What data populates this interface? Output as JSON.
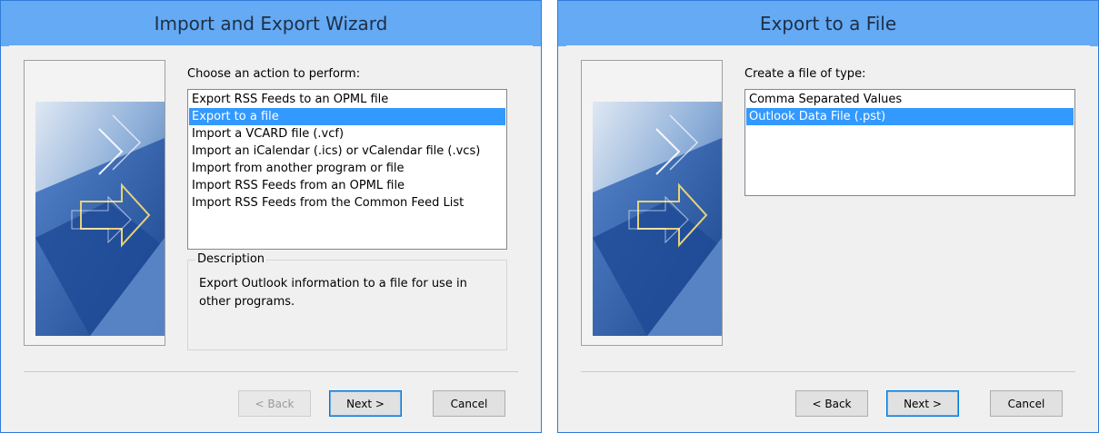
{
  "wizard_left": {
    "title": "Import and Export Wizard",
    "prompt": "Choose an action to perform:",
    "actions": [
      "Export RSS Feeds to an OPML file",
      "Export to a file",
      "Import a VCARD file (.vcf)",
      "Import an iCalendar (.ics) or vCalendar file (.vcs)",
      "Import from another program or file",
      "Import RSS Feeds from an OPML file",
      "Import RSS Feeds from the Common Feed List"
    ],
    "selected_action": "Export to a file",
    "description_label": "Description",
    "description_text": "Export Outlook information to a file for use in other programs.",
    "buttons": {
      "back": "< Back",
      "next": "Next >",
      "cancel": "Cancel"
    },
    "back_enabled": false
  },
  "wizard_right": {
    "title": "Export to a File",
    "prompt": "Create a file of type:",
    "file_types": [
      "Comma Separated Values",
      "Outlook Data File (.pst)"
    ],
    "selected_file_type": "Outlook Data File (.pst)",
    "buttons": {
      "back": "< Back",
      "next": "Next >",
      "cancel": "Cancel"
    },
    "back_enabled": true
  },
  "colors": {
    "title_bar": "#64aaf5",
    "selection": "#3399ff",
    "dialog_bg": "#f0f0f0"
  }
}
